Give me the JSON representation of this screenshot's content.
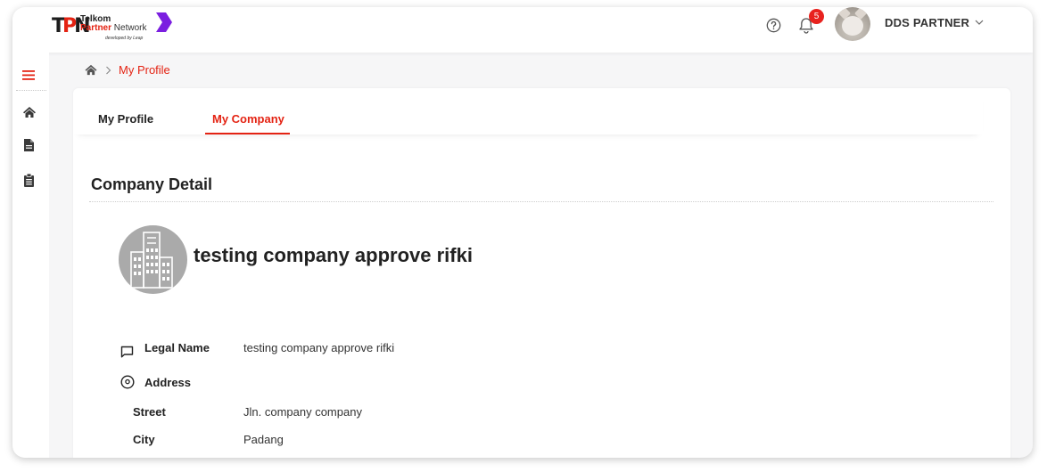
{
  "header": {
    "logo": {
      "line1": "Telkom",
      "line2_brand": "Partner",
      "line2_rest": " Network",
      "line3": "developed by Leap"
    },
    "notification_count": "5",
    "user_name": "DDS PARTNER"
  },
  "breadcrumb": {
    "current": "My Profile"
  },
  "tabs": [
    {
      "label": "My Profile",
      "active": false
    },
    {
      "label": "My Company",
      "active": true
    }
  ],
  "section": {
    "title": "Company Detail",
    "company_name": "testing company approve rifki"
  },
  "details": {
    "legal_name_label": "Legal Name",
    "legal_name_value": "testing company approve rifki",
    "address_label": "Address",
    "street_label": "Street",
    "street_value": "Jln. company company",
    "city_label": "City",
    "city_value": "Padang"
  },
  "colors": {
    "accent": "#e42313",
    "badge": "#e8231f",
    "logo_purple": "#7b1fe0"
  }
}
